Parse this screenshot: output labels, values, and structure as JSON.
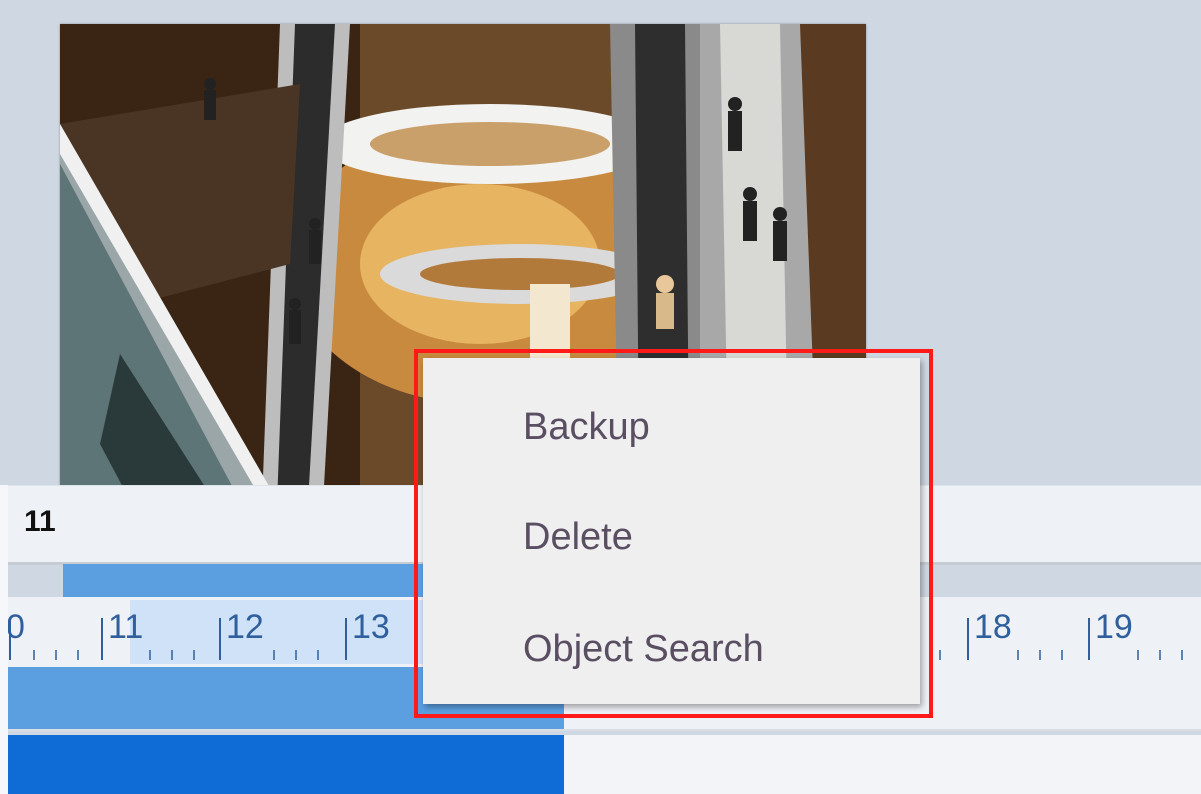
{
  "timeline": {
    "current_time_label": "11",
    "ruler_labels": [
      "0",
      "11",
      "12",
      "13",
      "18",
      "19"
    ]
  },
  "context_menu": {
    "items": [
      {
        "label": "Backup"
      },
      {
        "label": "Delete"
      },
      {
        "label": "Object Search"
      }
    ]
  },
  "colors": {
    "background": "#cfd7e2",
    "clip_bar": "#5b9fe1",
    "track_dark": "#0f6bd6",
    "ruler_selection": "#cfe2f7",
    "highlight": "#ff1a1a",
    "menu_text": "#5a4e63"
  }
}
